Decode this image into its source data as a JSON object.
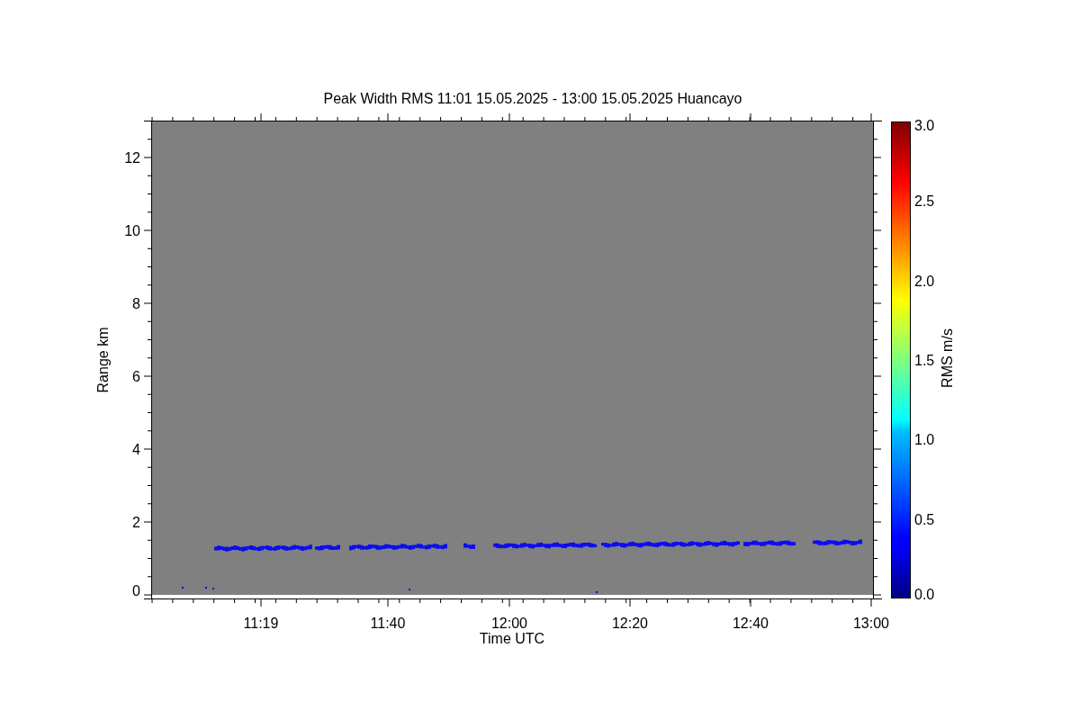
{
  "title": "Peak Width RMS   11:01 15.05.2025 - 13:00 15.05.2025 Huancayo",
  "x_axis": {
    "label": "Time UTC",
    "ticks": [
      "11:19",
      "11:40",
      "12:00",
      "12:20",
      "12:40",
      "13:00"
    ]
  },
  "y_axis": {
    "label": "Range km",
    "ticks": [
      "12",
      "10",
      "8",
      "6",
      "4",
      "2",
      "0"
    ]
  },
  "colorbar": {
    "label": "RMS m/s",
    "ticks": [
      "3.0",
      "2.5",
      "2.0",
      "1.5",
      "1.0",
      "0.5",
      "0.0"
    ]
  }
}
